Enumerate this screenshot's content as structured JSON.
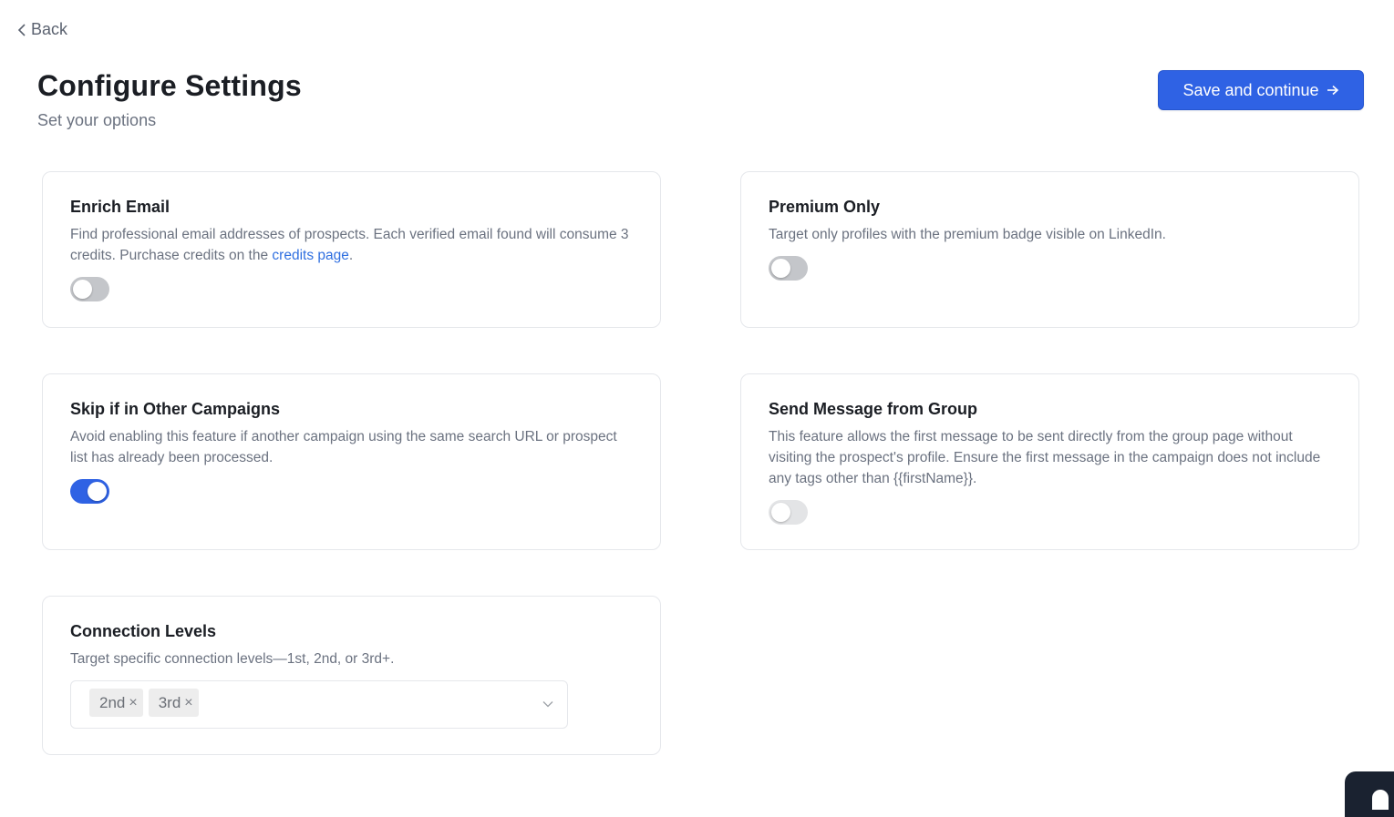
{
  "nav": {
    "back_label": "Back"
  },
  "header": {
    "title": "Configure Settings",
    "subtitle": "Set your options",
    "save_label": "Save and continue"
  },
  "settings": {
    "enrich_email": {
      "title": "Enrich Email",
      "description": "Find professional email addresses of prospects. Each verified email found will consume 3 credits. Purchase credits on the ",
      "link_text": "credits page",
      "description_end": ".",
      "enabled": false
    },
    "premium_only": {
      "title": "Premium Only",
      "description": "Target only profiles with the premium badge visible on LinkedIn.",
      "enabled": false
    },
    "skip_other_campaigns": {
      "title": "Skip if in Other Campaigns",
      "description": "Avoid enabling this feature if another campaign using the same search URL or prospect list has already been processed.",
      "enabled": true
    },
    "send_from_group": {
      "title": "Send Message from Group",
      "description": "This feature allows the first message to be sent directly from the group page without visiting the prospect's profile. Ensure the first message in the campaign does not include any tags other than {{firstName}}.",
      "enabled": false,
      "disabled": true
    },
    "connection_levels": {
      "title": "Connection Levels",
      "description": "Target specific connection levels—1st, 2nd, or 3rd+.",
      "selected": [
        "2nd",
        "3rd"
      ],
      "remove_glyph": "×"
    }
  },
  "colors": {
    "accent": "#2f62e4",
    "link": "#2f6fe0",
    "toggle_off": "#c4c6ca"
  }
}
